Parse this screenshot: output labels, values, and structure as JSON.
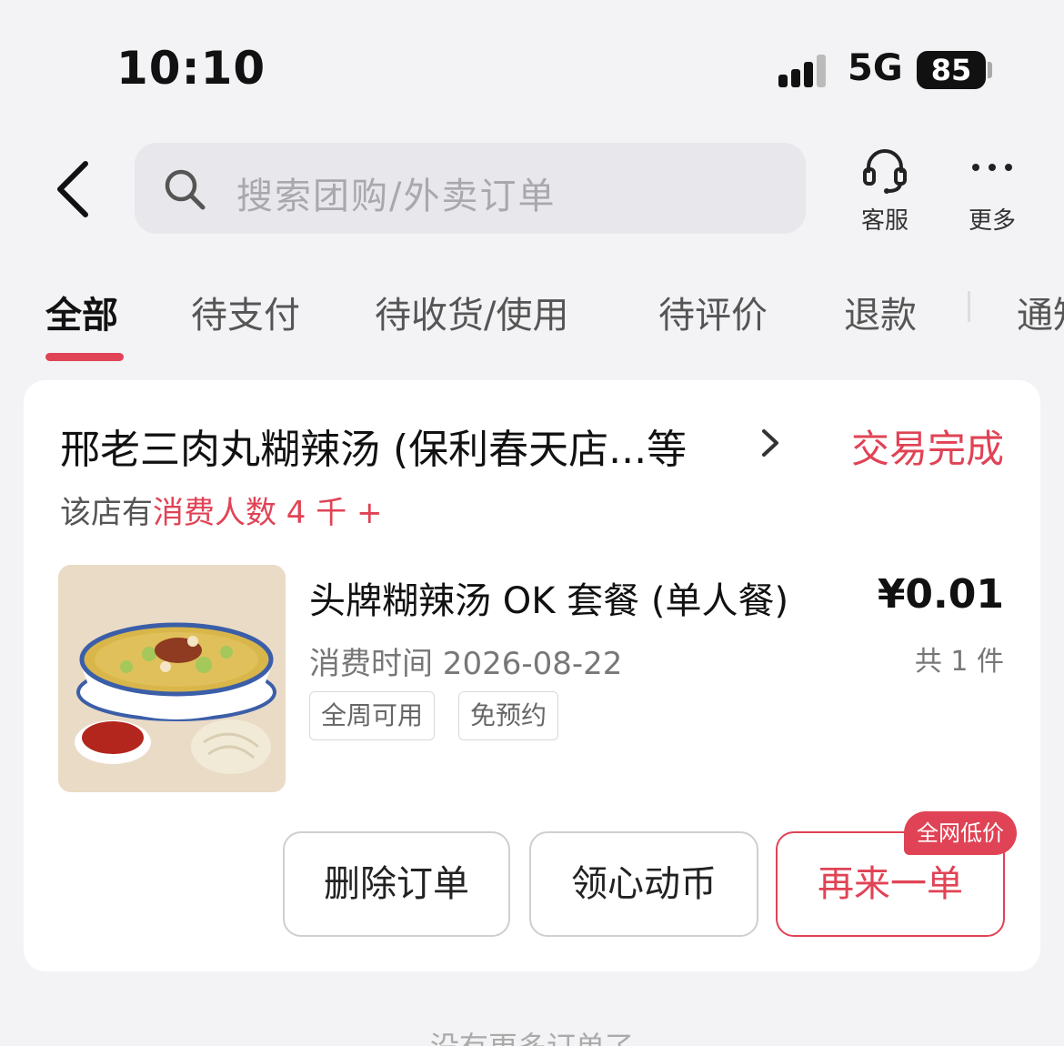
{
  "status_bar": {
    "time": "10:10",
    "network": "5G",
    "battery": "85"
  },
  "header": {
    "search_placeholder": "搜索团购/外卖订单",
    "actions": [
      {
        "label": "客服",
        "icon": "headset-icon"
      },
      {
        "label": "更多",
        "icon": "more-icon"
      }
    ]
  },
  "tabs": [
    {
      "label": "全部",
      "active": true
    },
    {
      "label": "待支付"
    },
    {
      "label": "待收货/使用"
    },
    {
      "label": "待评价"
    },
    {
      "label": "退款"
    },
    {
      "label": "通知"
    }
  ],
  "order": {
    "shop_name": "邢老三肉丸糊辣汤 (保利春天店...等",
    "status": "交易完成",
    "stat_prefix": "该店有",
    "stat_highlight": "消费人数 4 千 +",
    "product": {
      "name": "头牌糊辣汤 OK 套餐 (单人餐)",
      "time": "消费时间 2026-08-22",
      "tags": [
        "全周可用",
        "免预约"
      ],
      "price": "¥0.01",
      "quantity": "共 1 件"
    },
    "buttons": {
      "delete": "删除订单",
      "coins": "领心动币",
      "reorder": "再来一单",
      "promo_badge": "全网低价"
    },
    "accent_color": "#e04355"
  },
  "footer_note": "没有更多订单了"
}
